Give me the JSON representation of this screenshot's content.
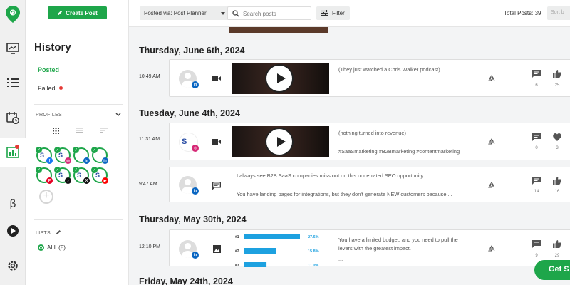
{
  "app": {
    "accent": "#1ea64a",
    "danger": "#e53935"
  },
  "sidebar": {
    "create_button": "Create Post",
    "title": "History",
    "nav": {
      "posted": "Posted",
      "failed": "Failed"
    },
    "profiles_label": "PROFILES",
    "lists_label": "LISTS",
    "list_all": "ALL (8)"
  },
  "toolbar": {
    "posted_via": "Posted via: Post Planner",
    "search_placeholder": "Search posts",
    "filter_label": "Filter",
    "total_posts": "Total Posts: 39",
    "sort_label": "Sort b"
  },
  "feed": {
    "groups": [
      {
        "date": "Thursday, June 6th, 2024",
        "posts": [
          {
            "time": "10:49 AM",
            "network": "linkedin",
            "type": "video",
            "text1": "(They just watched a Chris Walker podcast)",
            "text2": "...",
            "comments": "6",
            "likes": "25"
          }
        ]
      },
      {
        "date": "Tuesday, June 4th, 2024",
        "posts": [
          {
            "time": "11:31 AM",
            "network": "instagram",
            "type": "video",
            "text1": "(nothing turned into revenue)",
            "text2": "#SaaSmarketing #B2Bmarketing #contentmarketing",
            "comments": "0",
            "likes": "3"
          },
          {
            "time": "9:47 AM",
            "network": "linkedin",
            "type": "text",
            "text1": "I always see B2B SaaS companies miss out on this underrated SEO opportunity:",
            "text2": "You have landing pages for integrations, but they don't generate NEW customers because ...",
            "comments": "14",
            "likes": "16"
          }
        ]
      },
      {
        "date": "Thursday, May 30th, 2024",
        "posts": [
          {
            "time": "12:10 PM",
            "network": "linkedin",
            "type": "image",
            "text1": "You have a limited budget, and you need to pull the",
            "text1b": "levers with the greatest impact.",
            "text2": "...",
            "comments": "9",
            "likes": "29"
          }
        ]
      },
      {
        "date": "Friday, May 24th, 2024"
      }
    ]
  },
  "chart_data": {
    "type": "bar",
    "categories": [
      "#1",
      "#2",
      "#3"
    ],
    "values": [
      27.6,
      15.8,
      11.0
    ],
    "labels": [
      "27.6%",
      "15.8%",
      "11.0%"
    ]
  },
  "cta": {
    "label": "Get S"
  }
}
